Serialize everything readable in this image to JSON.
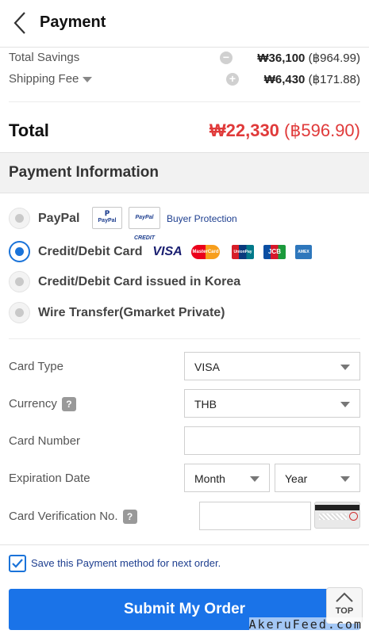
{
  "header": {
    "title": "Payment"
  },
  "summary": {
    "total_savings": {
      "label": "Total Savings",
      "krw": "₩36,100",
      "thb": "(฿964.99)"
    },
    "shipping_fee": {
      "label": "Shipping Fee",
      "krw": "₩6,430",
      "thb": "(฿171.88)"
    }
  },
  "total": {
    "label": "Total",
    "krw": "₩22,330",
    "thb": "(฿596.90)"
  },
  "payment_info": {
    "title": "Payment Information",
    "methods": [
      {
        "label": "PayPal",
        "selected": false
      },
      {
        "label": "Credit/Debit Card",
        "selected": true
      },
      {
        "label": "Credit/Debit Card issued in Korea",
        "selected": false
      },
      {
        "label": "Wire Transfer(Gmarket Private)",
        "selected": false
      }
    ],
    "paypal_logo": "PayPal",
    "paypal_credit_logo": "PayPal CREDIT",
    "buyer_protection": "Buyer Protection",
    "card_logos": [
      "VISA",
      "MasterCard",
      "UnionPay",
      "JCB",
      "AMEX"
    ]
  },
  "form": {
    "card_type": {
      "label": "Card Type",
      "value": "VISA"
    },
    "currency": {
      "label": "Currency",
      "value": "THB",
      "help": "?"
    },
    "card_number": {
      "label": "Card Number",
      "value": ""
    },
    "expiration": {
      "label": "Expiration Date",
      "month": "Month",
      "year": "Year"
    },
    "cvv": {
      "label": "Card Verification No.",
      "value": "",
      "help": "?"
    }
  },
  "save_method": {
    "label": "Save this Payment method for next order.",
    "checked": true
  },
  "submit": {
    "label": "Submit My Order"
  },
  "top_button": {
    "label": "TOP"
  },
  "watermark": "AkeruFeed.com",
  "colors": {
    "accent": "#1a73e8",
    "total_red": "#e03a3a",
    "link_blue": "#1d3e8f"
  }
}
